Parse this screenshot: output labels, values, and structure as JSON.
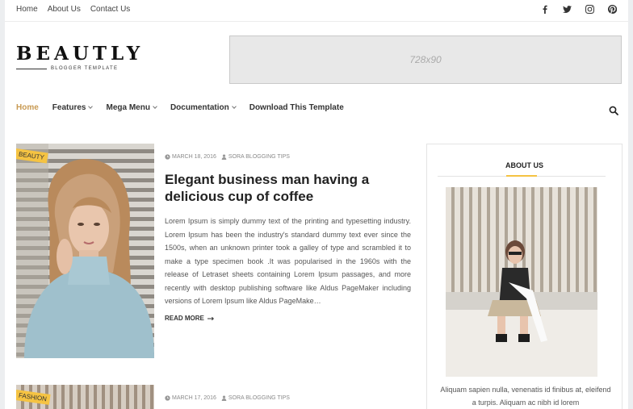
{
  "topbar": {
    "links": [
      "Home",
      "About Us",
      "Contact Us"
    ],
    "social_icons": [
      "facebook-icon",
      "twitter-icon",
      "instagram-icon",
      "pinterest-icon"
    ]
  },
  "header": {
    "logo_text": "BEAUTLY",
    "logo_tagline": "BLOGGER TEMPLATE",
    "ad_text": "728x90"
  },
  "nav": {
    "items": [
      {
        "label": "Home",
        "active": true,
        "dropdown": false
      },
      {
        "label": "Features",
        "active": false,
        "dropdown": true
      },
      {
        "label": "Mega Menu",
        "active": false,
        "dropdown": true
      },
      {
        "label": "Documentation",
        "active": false,
        "dropdown": true
      },
      {
        "label": "Download This Template",
        "active": false,
        "dropdown": false
      }
    ],
    "search_icon": "search-icon"
  },
  "posts": [
    {
      "label": "BEAUTY",
      "date": "MARCH 18, 2016",
      "author": "SORA BLOGGING TIPS",
      "title": "Elegant business man having a delicious cup of coffee",
      "excerpt": "Lorem Ipsum is simply dummy text of the printing and typesetting industry. Lorem Ipsum has been the industry's standard dummy text ever since the 1500s, when an unknown printer took a galley of type and scrambled it to make a type specimen book .It was popularised in the 1960s with the release of Letraset sheets containing Lorem Ipsum passages, and more recently with desktop publishing software like Aldus PageMaker including versions of Lorem Ipsum like Aldus PageMake…",
      "read_more": "READ MORE"
    },
    {
      "label": "FASHION",
      "date": "MARCH 17, 2016",
      "author": "SORA BLOGGING TIPS"
    }
  ],
  "sidebar": {
    "about_title": "ABOUT US",
    "about_text": "Aliquam sapien nulla, venenatis id finibus at, eleifend a turpis. Aliquam ac nibh id lorem"
  },
  "colors": {
    "accent": "#c89a53",
    "label_bg": "#f5c342"
  }
}
